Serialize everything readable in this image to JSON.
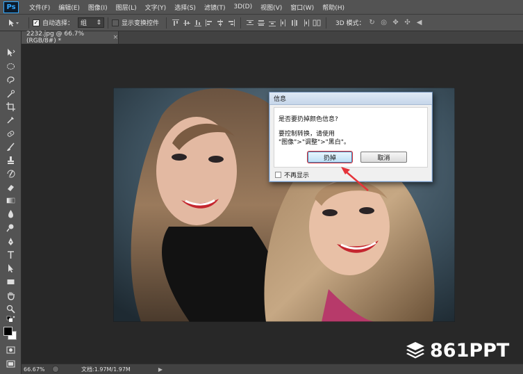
{
  "app": {
    "logo": "Ps"
  },
  "menu": [
    "文件(F)",
    "编辑(E)",
    "图像(I)",
    "图层(L)",
    "文字(Y)",
    "选择(S)",
    "滤镜(T)",
    "3D(D)",
    "视图(V)",
    "窗口(W)",
    "帮助(H)"
  ],
  "options": {
    "auto_select_label": "自动选择：",
    "auto_select_checked": true,
    "auto_select_value": "组",
    "show_transform_label": "显示变换控件",
    "show_transform_checked": false,
    "mode_3d_label": "3D 模式："
  },
  "document": {
    "tab_title": "2232.jpg @ 66.7%(RGB/8#) *",
    "close_glyph": "×"
  },
  "status": {
    "zoom": "66.67%",
    "doc_info": "文档:1.97M/1.97M",
    "arrow": "▶"
  },
  "dialog": {
    "title": "信息",
    "question": "是否要扔掉颜色信息?",
    "tip_line1": "要控制转换，请使用",
    "tip_line2": "\"图像\">\"调整\">\"黑白\"。",
    "discard_button": "扔掉",
    "cancel_button": "取消",
    "dont_show_label": "不再显示"
  },
  "watermark": {
    "text": "861PPT"
  },
  "colors": {
    "highlight_red": "#e5333a",
    "ui_dark": "#535353",
    "canvas_bg": "#282828"
  }
}
